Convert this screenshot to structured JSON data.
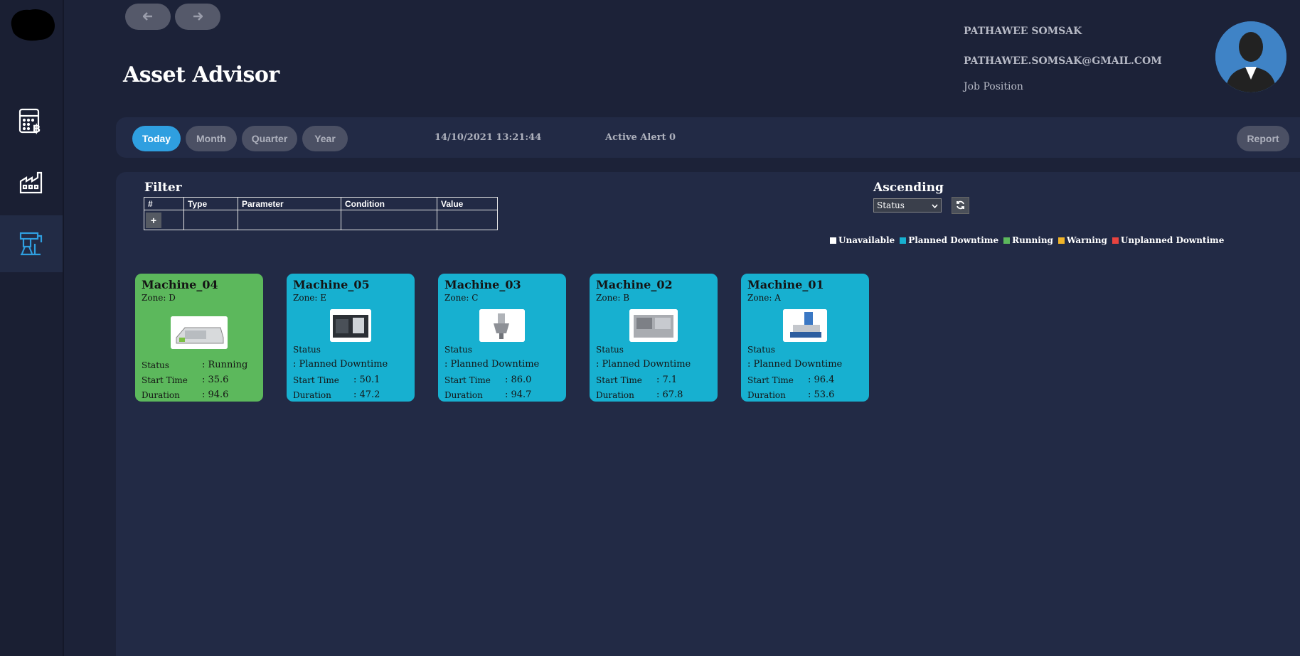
{
  "app": {
    "title": "Asset Advisor"
  },
  "user": {
    "name": "PATHAWEE SOMSAK",
    "email": "PATHAWEE.SOMSAK@GMAIL.COM",
    "position": "Job Position"
  },
  "sidebar": {
    "items": [
      {
        "icon": "calculator-icon"
      },
      {
        "icon": "factory-icon"
      },
      {
        "icon": "machine-arm-icon",
        "active": true
      }
    ]
  },
  "toolbar": {
    "periods": [
      "Today",
      "Month",
      "Quarter",
      "Year"
    ],
    "active_period": "Today",
    "datetime": "14/10/2021 13:21:44",
    "alert": "Active Alert 0",
    "report_label": "Report"
  },
  "filter": {
    "title": "Filter",
    "columns": [
      "#",
      "Type",
      "Parameter",
      "Condition",
      "Value"
    ],
    "add_label": "+"
  },
  "sort": {
    "title": "Ascending",
    "selected": "Status"
  },
  "legend": [
    {
      "label": "Unavailable",
      "color": "#ffffff"
    },
    {
      "label": "Planned Downtime",
      "color": "#17b0d0"
    },
    {
      "label": "Running",
      "color": "#5cb85c"
    },
    {
      "label": "Warning",
      "color": "#f0b429"
    },
    {
      "label": "Unplanned Downtime",
      "color": "#e8433f"
    }
  ],
  "machines": [
    {
      "name": "Machine_04",
      "zone": "Zone: D",
      "status_label": "Status",
      "status": ": Running",
      "start_label": "Start Time",
      "start": ": 35.6",
      "duration_label": "Duration",
      "duration": ": 94.6",
      "color": "#5cb85c"
    },
    {
      "name": "Machine_05",
      "zone": "Zone: E",
      "status_label": "Status",
      "status": ": Planned Downtime",
      "start_label": "Start Time",
      "start": ": 50.1",
      "duration_label": "Duration",
      "duration": ": 47.2",
      "color": "#17b0d0"
    },
    {
      "name": "Machine_03",
      "zone": "Zone: C",
      "status_label": "Status",
      "status": ": Planned Downtime",
      "start_label": "Start Time",
      "start": ": 86.0",
      "duration_label": "Duration",
      "duration": ": 94.7",
      "color": "#17b0d0"
    },
    {
      "name": "Machine_02",
      "zone": "Zone: B",
      "status_label": "Status",
      "status": ": Planned Downtime",
      "start_label": "Start Time",
      "start": ": 7.1",
      "duration_label": "Duration",
      "duration": ": 67.8",
      "color": "#17b0d0"
    },
    {
      "name": "Machine_01",
      "zone": "Zone: A",
      "status_label": "Status",
      "status": ": Planned Downtime",
      "start_label": "Start Time",
      "start": ": 96.4",
      "duration_label": "Duration",
      "duration": ": 53.6",
      "color": "#17b0d0"
    }
  ]
}
